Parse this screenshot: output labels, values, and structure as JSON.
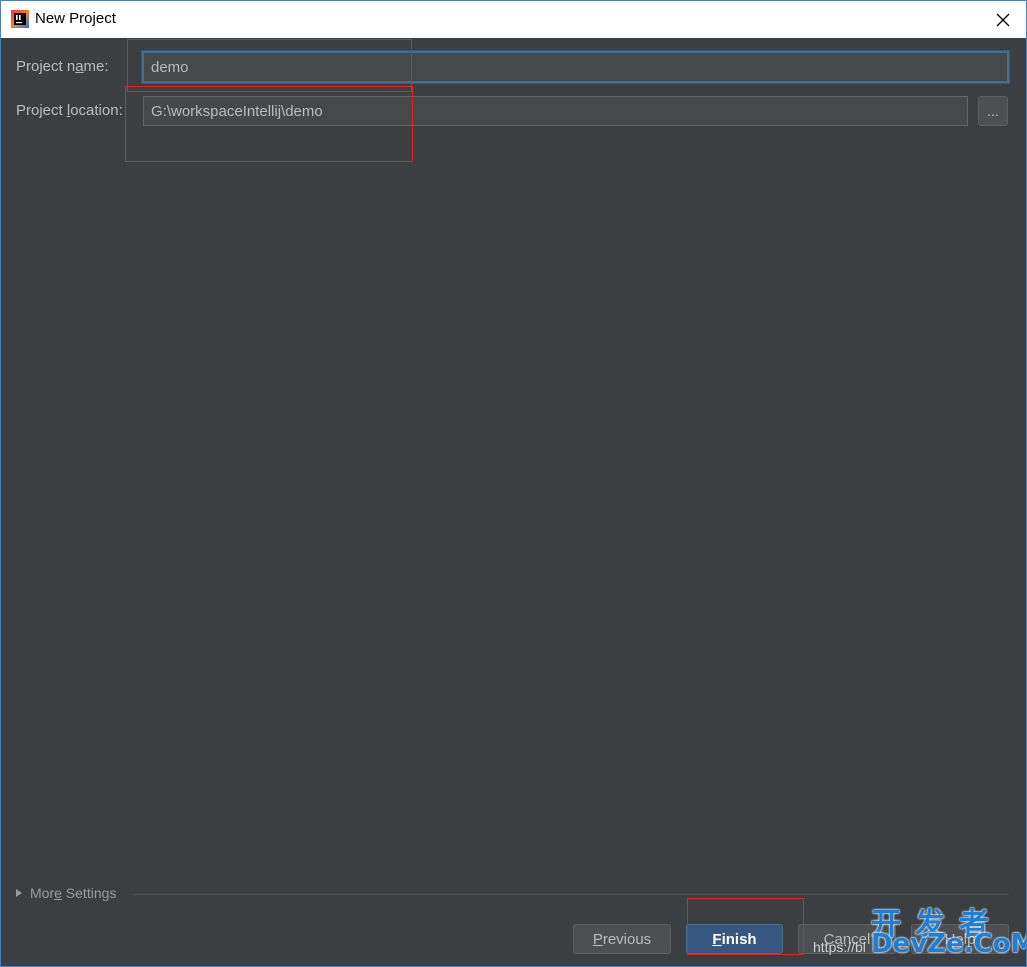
{
  "window": {
    "title": "New Project",
    "icon": "intellij-idea-icon",
    "close_icon": "close-icon"
  },
  "form": {
    "project_name": {
      "label_before": "Project n",
      "label_mnemonic": "a",
      "label_after": "me:",
      "value": "demo"
    },
    "project_location": {
      "label_before": "Project ",
      "label_mnemonic": "l",
      "label_after": "ocation:",
      "value": "G:\\workspaceIntellij\\demo",
      "browse_label": "..."
    }
  },
  "more_settings": {
    "label_before": "Mor",
    "label_mnemonic": "e",
    "label_after": " Settings"
  },
  "buttons": {
    "previous": {
      "mnemonic": "P",
      "rest": "revious"
    },
    "finish": {
      "mnemonic": "F",
      "rest": "inish"
    },
    "cancel": "Cancel",
    "help": "Help"
  },
  "watermark": {
    "url": "https://bl",
    "cn": "开发者",
    "en": "DevZe.CoM"
  },
  "colors": {
    "background": "#3c3f41",
    "accent": "#365880",
    "focus_border": "#466d94",
    "annotation": "#e0241b",
    "watermark": "#1e7fd8"
  }
}
